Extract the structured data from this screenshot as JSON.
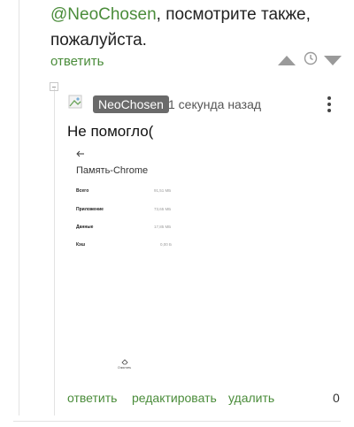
{
  "parent_comment": {
    "mention": "@NeoChosen",
    "text_rest": ", посмотрите также, пожалуйста.",
    "reply_label": "ответить"
  },
  "comment": {
    "author": "NeoChosen",
    "time": "1 секунда назад",
    "text": "Не помогло(",
    "screenshot": {
      "title": "Память-Chrome",
      "rows": [
        {
          "label": "Всего",
          "value": "91,51 МБ"
        },
        {
          "label": "Приложение",
          "value": "73,65 МБ"
        },
        {
          "label": "Данные",
          "value": "17,85 МБ"
        },
        {
          "label": "Кэш",
          "value": "0,00 Б"
        }
      ],
      "clear_label": "Очистить"
    },
    "actions": {
      "reply": "ответить",
      "edit": "редактировать",
      "delete": "удалить"
    },
    "rating": "0"
  },
  "icons": {
    "upvote": "upvote-triangle-icon",
    "downvote": "downvote-triangle-icon",
    "history": "clock-icon",
    "collapse": "collapse-minus-icon",
    "avatar": "broken-image-avatar-icon",
    "more": "kebab-menu-icon",
    "back": "back-arrow-icon",
    "clear": "eraser-icon"
  },
  "colors": {
    "link_green": "#4a8c3a",
    "author_chip": "#6a6a6a",
    "vote_gray": "#9a9a9a"
  }
}
